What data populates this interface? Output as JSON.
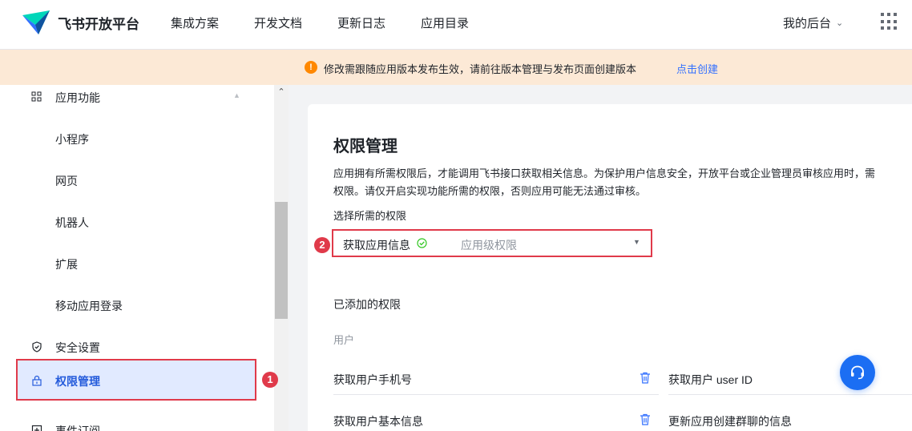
{
  "header": {
    "brand": "飞书开放平台",
    "nav": [
      "集成方案",
      "开发文档",
      "更新日志",
      "应用目录"
    ],
    "console": "我的后台"
  },
  "notice": {
    "text": "修改需跟随应用版本发布生效，请前往版本管理与发布页面创建版本",
    "link": "点击创建"
  },
  "sidebar": {
    "section": "应用功能",
    "items": [
      "小程序",
      "网页",
      "机器人",
      "扩展",
      "移动应用登录"
    ],
    "security": "安全设置",
    "permissions": "权限管理",
    "events": "事件订阅",
    "badge": "1"
  },
  "main": {
    "title": "权限管理",
    "desc_line1": "应用拥有所需权限后，才能调用飞书接口获取相关信息。为保护用户信息安全，开放平台或企业管理员审核应用时，需",
    "desc_line2": "权限。请仅开启实现功能所需的权限，否则应用可能无法通过审核。",
    "select_label": "选择所需的权限",
    "select_value": "获取应用信息",
    "select_scope": "应用级权限",
    "badge": "2",
    "added_label": "已添加的权限",
    "group_label": "用户",
    "perms_left": [
      "获取用户手机号",
      "获取用户基本信息"
    ],
    "perms_right": [
      "获取用户 user ID",
      "更新应用创建群聊的信息"
    ]
  },
  "colors": {
    "accent": "#3370ff",
    "highlight_border": "#e03a4a",
    "notice_bg": "#fce9d6",
    "help_button": "#1b6ef3"
  }
}
